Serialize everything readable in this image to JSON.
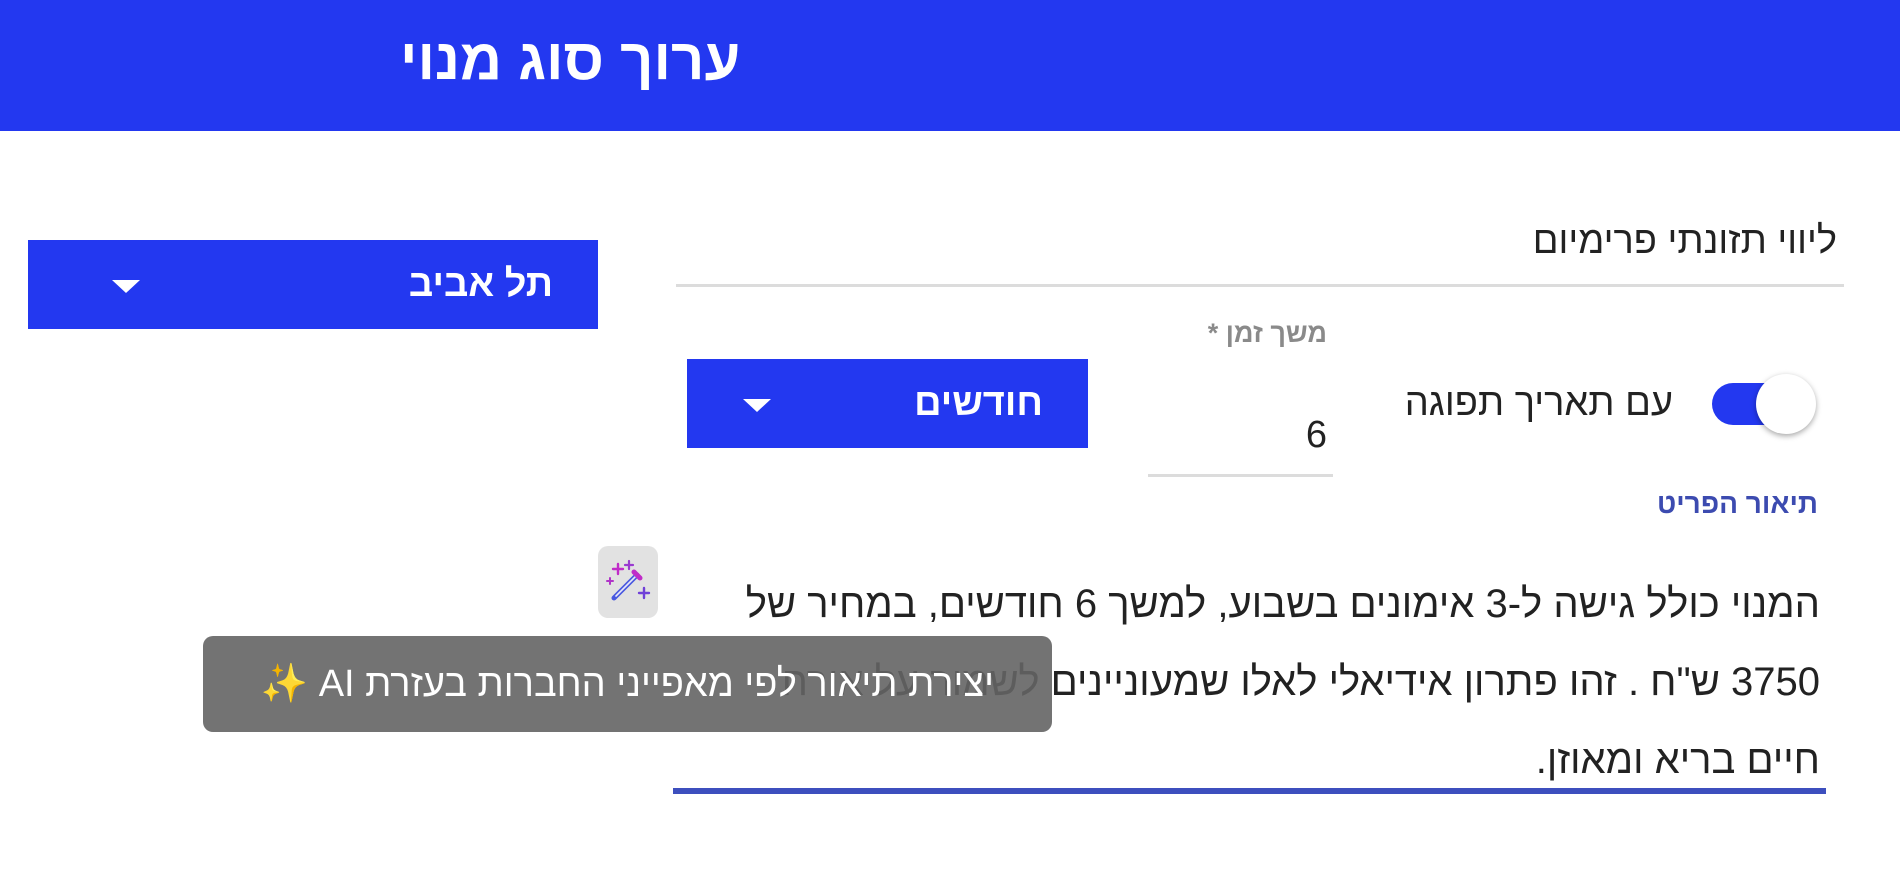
{
  "header": {
    "title": "ערוך סוג מנוי"
  },
  "city_select": {
    "value": "תל אביב",
    "icon": "caret-down-icon"
  },
  "form": {
    "name_value": "ליווי תזונתי פרימיום",
    "duration": {
      "label": "משך זמן *",
      "value": "6"
    },
    "duration_unit": {
      "value": "חודשים",
      "icon": "caret-down-icon"
    },
    "expiry_toggle": {
      "label": "עם תאריך תפוגה",
      "on": true
    },
    "description": {
      "label": "תיאור הפריט",
      "value": "המנוי כולל גישה ל-3 אימונים בשבוע, למשך 6 חודשים, במחיר של 3750 ש\"ח . זהו פתרון אידיאלי לאלו שמעוניינים לשמור על אורח חיים בריא ומאוזן."
    }
  },
  "ai_button": {
    "icon": "magic-wand-icon"
  },
  "tooltip": {
    "text": "יצירת תיאור לפי מאפייני החברות בעזרת AI ✨"
  },
  "colors": {
    "primary": "#2338f0",
    "accent_underline": "#3d4fbe",
    "label_blue": "#3c4bb0"
  }
}
